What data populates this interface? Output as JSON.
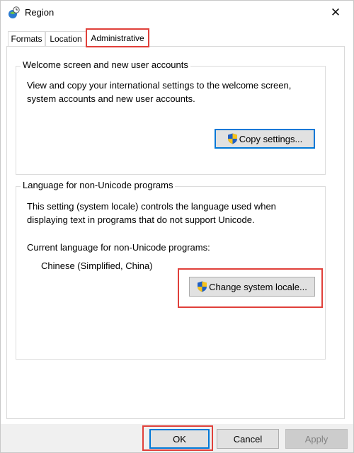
{
  "window": {
    "title": "Region",
    "close_glyph": "✕"
  },
  "tabs": [
    {
      "label": "Formats",
      "selected": false
    },
    {
      "label": "Location",
      "selected": false
    },
    {
      "label": "Administrative",
      "selected": true
    }
  ],
  "welcome_group": {
    "title": "Welcome screen and new user accounts",
    "description_line1": "View and copy your international settings to the welcome screen,",
    "description_line2": "system accounts and new user accounts.",
    "copy_button_label": "Copy settings...",
    "copy_button_icon": "uac-shield-icon"
  },
  "language_group": {
    "title": "Language for non-Unicode programs",
    "description_line1": "This setting (system locale) controls the language used when",
    "description_line2": "displaying text in programs that do not support Unicode.",
    "current_label": "Current language for non-Unicode programs:",
    "current_value": "Chinese (Simplified, China)",
    "change_button_label": "Change system locale...",
    "change_button_icon": "uac-shield-icon"
  },
  "footer": {
    "ok_label": "OK",
    "cancel_label": "Cancel",
    "apply_label": "Apply"
  },
  "colors": {
    "highlight": "#e0403a",
    "focus_border": "#0078d7",
    "button_face": "#e1e1e1",
    "footer_bg": "#f0f0f0"
  }
}
